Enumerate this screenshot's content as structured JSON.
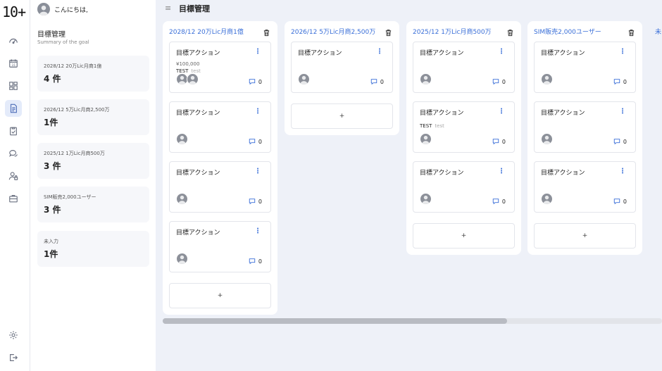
{
  "app": {
    "logo": "10+"
  },
  "user": {
    "greeting": "こんにちは,"
  },
  "header": {
    "title": "目標管理"
  },
  "sidebar": {
    "title": "目標管理",
    "subtitle": "Summary of the goal",
    "goals": [
      {
        "name": "2028/12 20万Lic月商1億",
        "count": "4 件"
      },
      {
        "name": "2026/12 5万Lic月商2,500万",
        "count": "1件"
      },
      {
        "name": "2025/12 1万Lic月商500万",
        "count": "3 件"
      },
      {
        "name": "SIM販売2,000ユーザー",
        "count": "3 件"
      },
      {
        "name": "未入力",
        "count": "1件"
      }
    ]
  },
  "board": {
    "add_label": "+",
    "columns": [
      {
        "title": "2028/12 20万Lic月商1億",
        "cards": [
          {
            "title": "目標アクション",
            "amount": "¥100,000",
            "tag": "TEST",
            "tag_sub": "test",
            "avatars": 2,
            "comments": "0"
          },
          {
            "title": "目標アクション",
            "avatars": 1,
            "comments": "0"
          },
          {
            "title": "目標アクション",
            "avatars": 1,
            "comments": "0"
          },
          {
            "title": "目標アクション",
            "avatars": 1,
            "comments": "0"
          }
        ]
      },
      {
        "title": "2026/12 5万Lic月商2,500万",
        "cards": [
          {
            "title": "目標アクション",
            "avatars": 1,
            "comments": "0"
          }
        ]
      },
      {
        "title": "2025/12 1万Lic月商500万",
        "cards": [
          {
            "title": "目標アクション",
            "avatars": 1,
            "comments": "0"
          },
          {
            "title": "目標アクション",
            "tag": "TEST",
            "tag_sub": "test",
            "avatars": 1,
            "comments": "0"
          },
          {
            "title": "目標アクション",
            "avatars": 1,
            "comments": "0"
          }
        ]
      },
      {
        "title": "SIM販売2,000ユーザー",
        "cards": [
          {
            "title": "目標アクション",
            "avatars": 1,
            "comments": "0"
          },
          {
            "title": "目標アクション",
            "avatars": 1,
            "comments": "0"
          },
          {
            "title": "目標アクション",
            "avatars": 1,
            "comments": "0"
          }
        ]
      }
    ],
    "partial_column_title": "未"
  },
  "icons": {
    "rail": [
      "dashboard-icon",
      "calendar-icon",
      "board-icon",
      "document-icon",
      "clipboard-check-icon",
      "chat-icon",
      "user-lock-icon",
      "briefcase-icon",
      "settings-icon",
      "logout-icon"
    ],
    "delete": "trash-icon",
    "comment": "comment-icon",
    "menu": "menu-icon"
  },
  "colors": {
    "accent": "#3a6fd8",
    "active_bg": "#e4ebfa",
    "background": "#eef1f8"
  }
}
